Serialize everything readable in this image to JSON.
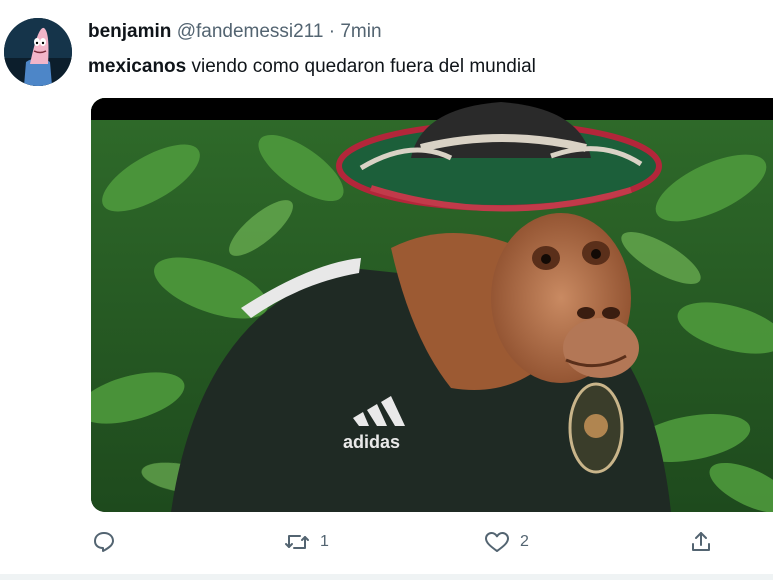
{
  "tweet": {
    "display_name": "benjamin",
    "handle": "@fandemessi211",
    "separator": "·",
    "time": "7min",
    "text_bold": "mexicanos",
    "text_rest": " viendo como quedaron fuera del mundial"
  },
  "media": {
    "shirt_brand": "adidas",
    "description_icon": "orangutan-meme-image"
  },
  "actions": {
    "reply_icon": "reply-icon",
    "retweet_icon": "retweet-icon",
    "retweet_count": "1",
    "like_icon": "heart-icon",
    "like_count": "2",
    "share_icon": "share-icon"
  },
  "colors": {
    "text_primary": "#0f1419",
    "text_secondary": "#536471",
    "divider": "#eff3f4"
  }
}
